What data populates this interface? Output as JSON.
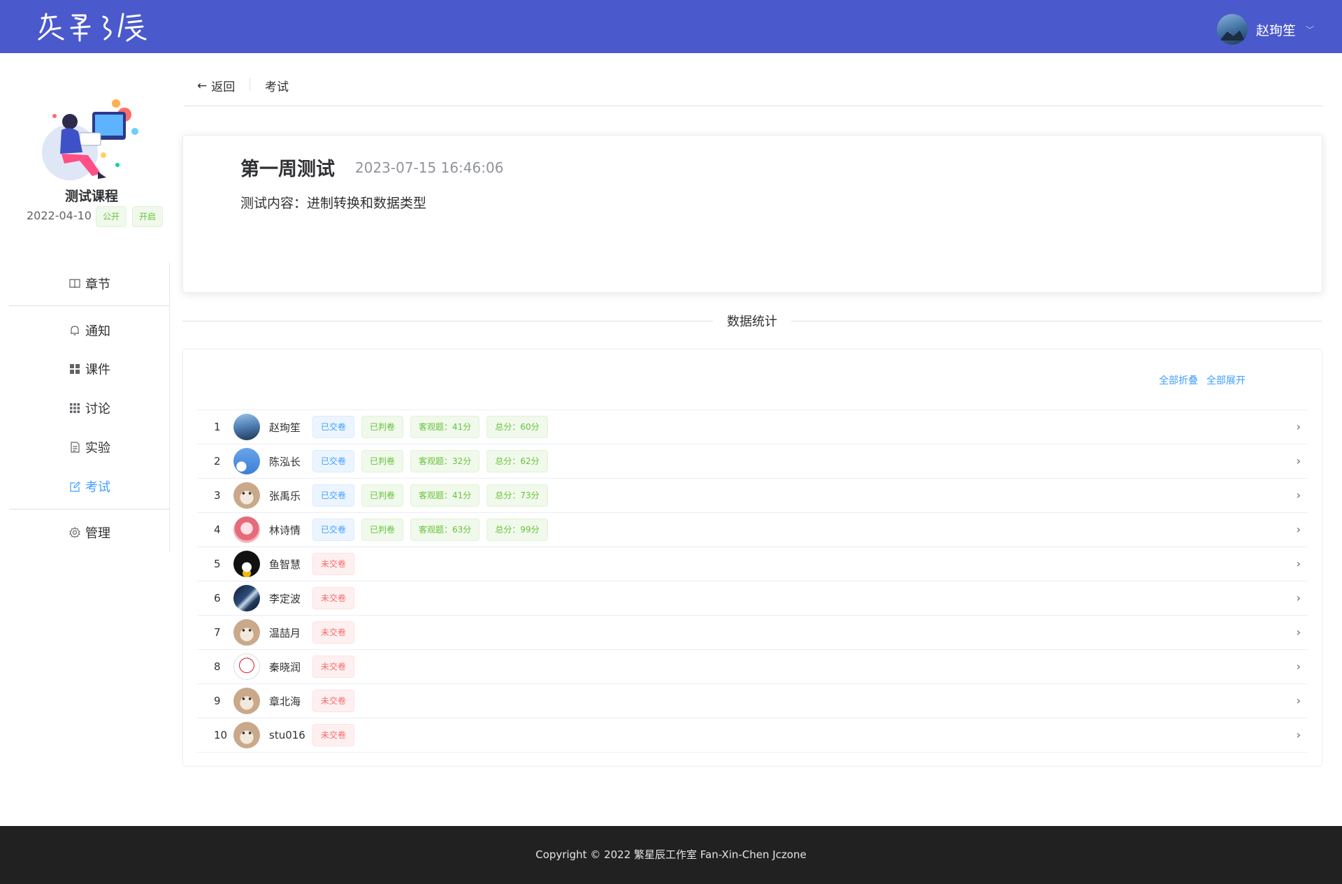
{
  "header": {
    "logo_alt": "繁星之辰",
    "user_name": "赵珣笙",
    "caret": "﹀",
    "brand_color": "#4a59cc"
  },
  "sidebar": {
    "course_name": "测试课程",
    "course_date": "2022-04-10",
    "tags": [
      "公开",
      "开启"
    ],
    "menu": [
      {
        "label": "章节",
        "icon": "book-icon"
      },
      {
        "label": "通知",
        "icon": "bell-icon"
      },
      {
        "label": "课件",
        "icon": "grid-icon"
      },
      {
        "label": "讨论",
        "icon": "apps-icon"
      },
      {
        "label": "实验",
        "icon": "document-icon"
      },
      {
        "label": "考试",
        "icon": "edit-icon",
        "active": true
      },
      {
        "label": "管理",
        "icon": "gear-icon"
      }
    ]
  },
  "breadcrumb": {
    "back_label": "返回",
    "current": "考试"
  },
  "exam": {
    "title": "第一周测试",
    "time": "2023-07-15 16:46:06",
    "content": "测试内容：进制转换和数据类型"
  },
  "stats": {
    "section_title": "数据统计",
    "collapse_all": "全部折叠",
    "expand_all": "全部展开",
    "students": [
      {
        "index": "1",
        "name": "赵珣笙",
        "avatar": "mountain",
        "tags": [
          {
            "text": "已交卷",
            "type": "blue"
          },
          {
            "text": "已判卷",
            "type": "green"
          },
          {
            "text": "客观题：41分",
            "type": "green"
          },
          {
            "text": "总分：60分",
            "type": "green"
          }
        ]
      },
      {
        "index": "2",
        "name": "陈泓长",
        "avatar": "sky",
        "tags": [
          {
            "text": "已交卷",
            "type": "blue"
          },
          {
            "text": "已判卷",
            "type": "green"
          },
          {
            "text": "客观题：32分",
            "type": "green"
          },
          {
            "text": "总分：62分",
            "type": "green"
          }
        ]
      },
      {
        "index": "3",
        "name": "张禹乐",
        "avatar": "dog",
        "tags": [
          {
            "text": "已交卷",
            "type": "blue"
          },
          {
            "text": "已判卷",
            "type": "green"
          },
          {
            "text": "客观题：41分",
            "type": "green"
          },
          {
            "text": "总分：73分",
            "type": "green"
          }
        ]
      },
      {
        "index": "4",
        "name": "林诗情",
        "avatar": "pink",
        "tags": [
          {
            "text": "已交卷",
            "type": "blue"
          },
          {
            "text": "已判卷",
            "type": "green"
          },
          {
            "text": "客观题：63分",
            "type": "green"
          },
          {
            "text": "总分：99分",
            "type": "green"
          }
        ]
      },
      {
        "index": "5",
        "name": "鱼智慧",
        "avatar": "penguin",
        "tags": [
          {
            "text": "未交卷",
            "type": "red"
          }
        ]
      },
      {
        "index": "6",
        "name": "李定波",
        "avatar": "night",
        "tags": [
          {
            "text": "未交卷",
            "type": "red"
          }
        ]
      },
      {
        "index": "7",
        "name": "温喆月",
        "avatar": "dog",
        "tags": [
          {
            "text": "未交卷",
            "type": "red"
          }
        ]
      },
      {
        "index": "8",
        "name": "秦晓润",
        "avatar": "sketch",
        "tags": [
          {
            "text": "未交卷",
            "type": "red"
          }
        ]
      },
      {
        "index": "9",
        "name": "章北海",
        "avatar": "dog",
        "tags": [
          {
            "text": "未交卷",
            "type": "red"
          }
        ]
      },
      {
        "index": "10",
        "name": "stu016",
        "avatar": "dog",
        "tags": [
          {
            "text": "未交卷",
            "type": "red"
          }
        ]
      }
    ]
  },
  "footer": {
    "copyright": "Copyright © 2022 繁星辰工作室 Fan-Xin-Chen Jczone"
  }
}
